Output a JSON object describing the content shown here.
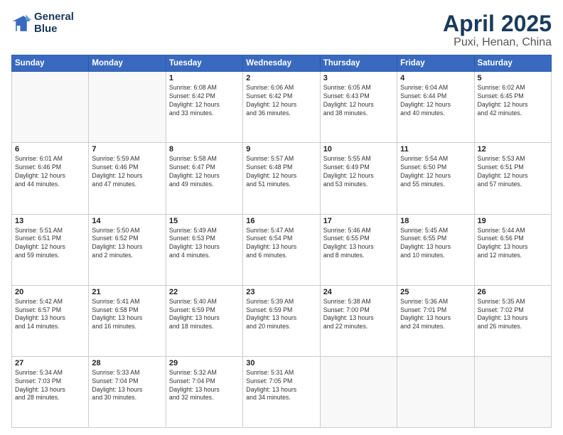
{
  "logo": {
    "line1": "General",
    "line2": "Blue"
  },
  "title": "April 2025",
  "subtitle": "Puxi, Henan, China",
  "weekdays": [
    "Sunday",
    "Monday",
    "Tuesday",
    "Wednesday",
    "Thursday",
    "Friday",
    "Saturday"
  ],
  "weeks": [
    [
      {
        "day": "",
        "info": ""
      },
      {
        "day": "",
        "info": ""
      },
      {
        "day": "1",
        "info": "Sunrise: 6:08 AM\nSunset: 6:42 PM\nDaylight: 12 hours\nand 33 minutes."
      },
      {
        "day": "2",
        "info": "Sunrise: 6:06 AM\nSunset: 6:42 PM\nDaylight: 12 hours\nand 36 minutes."
      },
      {
        "day": "3",
        "info": "Sunrise: 6:05 AM\nSunset: 6:43 PM\nDaylight: 12 hours\nand 38 minutes."
      },
      {
        "day": "4",
        "info": "Sunrise: 6:04 AM\nSunset: 6:44 PM\nDaylight: 12 hours\nand 40 minutes."
      },
      {
        "day": "5",
        "info": "Sunrise: 6:02 AM\nSunset: 6:45 PM\nDaylight: 12 hours\nand 42 minutes."
      }
    ],
    [
      {
        "day": "6",
        "info": "Sunrise: 6:01 AM\nSunset: 6:46 PM\nDaylight: 12 hours\nand 44 minutes."
      },
      {
        "day": "7",
        "info": "Sunrise: 5:59 AM\nSunset: 6:46 PM\nDaylight: 12 hours\nand 47 minutes."
      },
      {
        "day": "8",
        "info": "Sunrise: 5:58 AM\nSunset: 6:47 PM\nDaylight: 12 hours\nand 49 minutes."
      },
      {
        "day": "9",
        "info": "Sunrise: 5:57 AM\nSunset: 6:48 PM\nDaylight: 12 hours\nand 51 minutes."
      },
      {
        "day": "10",
        "info": "Sunrise: 5:55 AM\nSunset: 6:49 PM\nDaylight: 12 hours\nand 53 minutes."
      },
      {
        "day": "11",
        "info": "Sunrise: 5:54 AM\nSunset: 6:50 PM\nDaylight: 12 hours\nand 55 minutes."
      },
      {
        "day": "12",
        "info": "Sunrise: 5:53 AM\nSunset: 6:51 PM\nDaylight: 12 hours\nand 57 minutes."
      }
    ],
    [
      {
        "day": "13",
        "info": "Sunrise: 5:51 AM\nSunset: 6:51 PM\nDaylight: 12 hours\nand 59 minutes."
      },
      {
        "day": "14",
        "info": "Sunrise: 5:50 AM\nSunset: 6:52 PM\nDaylight: 13 hours\nand 2 minutes."
      },
      {
        "day": "15",
        "info": "Sunrise: 5:49 AM\nSunset: 6:53 PM\nDaylight: 13 hours\nand 4 minutes."
      },
      {
        "day": "16",
        "info": "Sunrise: 5:47 AM\nSunset: 6:54 PM\nDaylight: 13 hours\nand 6 minutes."
      },
      {
        "day": "17",
        "info": "Sunrise: 5:46 AM\nSunset: 6:55 PM\nDaylight: 13 hours\nand 8 minutes."
      },
      {
        "day": "18",
        "info": "Sunrise: 5:45 AM\nSunset: 6:55 PM\nDaylight: 13 hours\nand 10 minutes."
      },
      {
        "day": "19",
        "info": "Sunrise: 5:44 AM\nSunset: 6:56 PM\nDaylight: 13 hours\nand 12 minutes."
      }
    ],
    [
      {
        "day": "20",
        "info": "Sunrise: 5:42 AM\nSunset: 6:57 PM\nDaylight: 13 hours\nand 14 minutes."
      },
      {
        "day": "21",
        "info": "Sunrise: 5:41 AM\nSunset: 6:58 PM\nDaylight: 13 hours\nand 16 minutes."
      },
      {
        "day": "22",
        "info": "Sunrise: 5:40 AM\nSunset: 6:59 PM\nDaylight: 13 hours\nand 18 minutes."
      },
      {
        "day": "23",
        "info": "Sunrise: 5:39 AM\nSunset: 6:59 PM\nDaylight: 13 hours\nand 20 minutes."
      },
      {
        "day": "24",
        "info": "Sunrise: 5:38 AM\nSunset: 7:00 PM\nDaylight: 13 hours\nand 22 minutes."
      },
      {
        "day": "25",
        "info": "Sunrise: 5:36 AM\nSunset: 7:01 PM\nDaylight: 13 hours\nand 24 minutes."
      },
      {
        "day": "26",
        "info": "Sunrise: 5:35 AM\nSunset: 7:02 PM\nDaylight: 13 hours\nand 26 minutes."
      }
    ],
    [
      {
        "day": "27",
        "info": "Sunrise: 5:34 AM\nSunset: 7:03 PM\nDaylight: 13 hours\nand 28 minutes."
      },
      {
        "day": "28",
        "info": "Sunrise: 5:33 AM\nSunset: 7:04 PM\nDaylight: 13 hours\nand 30 minutes."
      },
      {
        "day": "29",
        "info": "Sunrise: 5:32 AM\nSunset: 7:04 PM\nDaylight: 13 hours\nand 32 minutes."
      },
      {
        "day": "30",
        "info": "Sunrise: 5:31 AM\nSunset: 7:05 PM\nDaylight: 13 hours\nand 34 minutes."
      },
      {
        "day": "",
        "info": ""
      },
      {
        "day": "",
        "info": ""
      },
      {
        "day": "",
        "info": ""
      }
    ]
  ]
}
